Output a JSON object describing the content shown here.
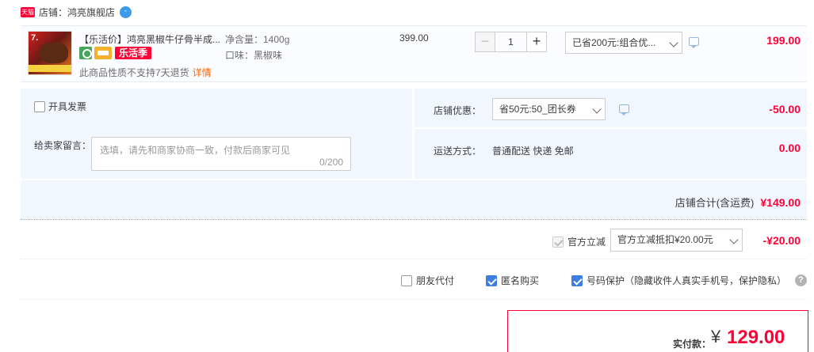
{
  "shop": {
    "badge": "天猫",
    "name": "店铺：鸿亮旗舰店"
  },
  "item": {
    "title": "【乐活价】鸿亮黑椒牛仔骨半成...",
    "promo_badge": "乐活季",
    "return_note": "此商品性质不支持7天退货",
    "return_detail": "详情",
    "spec_weight": "净含量：1400g",
    "spec_flavor": "口味：黑椒味",
    "unit_price": "399.00",
    "quantity": "1",
    "minus": "−",
    "plus": "+",
    "promo_selected": "已省200元:组合优...",
    "total": "199.00"
  },
  "extras": {
    "invoice_label": "开具发票",
    "message_label": "给卖家留言：",
    "message_placeholder": "选填，请先和商家协商一致，付款后商家可见",
    "message_count": "0/200",
    "coupon_label": "店铺优惠：",
    "coupon_selected": "省50元:50_团长券",
    "coupon_amount": "-50.00",
    "shipping_label": "运送方式：",
    "shipping_value": "普通配送 快递 免邮",
    "shipping_amount": "0.00",
    "shop_total_label": "店铺合计(含运费)",
    "shop_total_amount": "¥149.00"
  },
  "official": {
    "label": "官方立减",
    "selected": "官方立减抵扣¥20.00元",
    "amount": "-¥20.00"
  },
  "options": {
    "friend_pay": "朋友代付",
    "anonymous": "匿名购买",
    "phone_protect": "号码保护（隐藏收件人真实手机号，保护隐私）",
    "help": "?"
  },
  "payment": {
    "label": "实付款：",
    "yen": "¥",
    "amount": "129.00"
  }
}
